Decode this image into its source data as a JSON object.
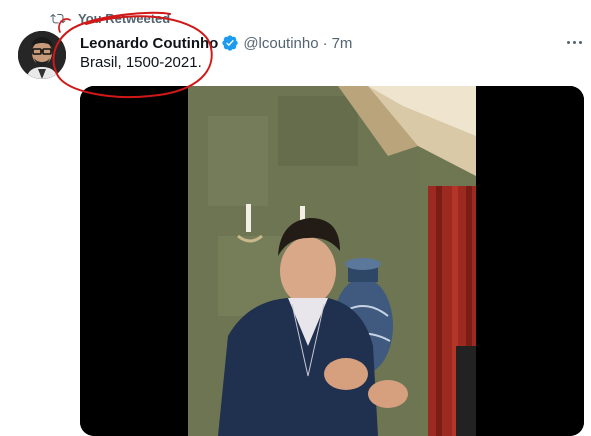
{
  "retweet": {
    "label": "You Retweeted",
    "icon": "retweet-icon"
  },
  "tweet": {
    "author_name": "Leonardo Coutinho",
    "verified": true,
    "handle": "@lcoutinho",
    "separator": "·",
    "time": "7m",
    "text": "Brasil, 1500-2021.",
    "more_icon": "more-options-icon"
  },
  "media": {
    "type": "video"
  },
  "colors": {
    "text_primary": "#0f1419",
    "text_secondary": "#536471",
    "verified_blue": "#1d9bf0",
    "annotation_red": "#d01818"
  }
}
